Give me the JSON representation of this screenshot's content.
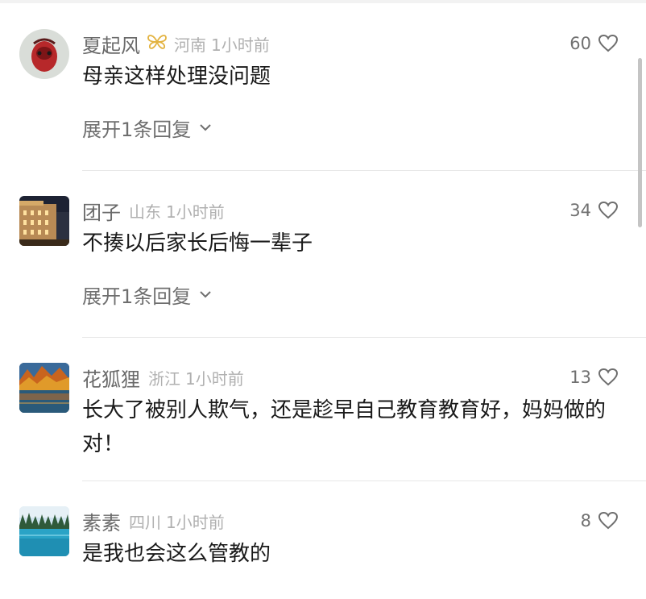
{
  "comments": [
    {
      "username": "夏起风",
      "badge_icon": "butterfly-badge-icon",
      "location": "河南",
      "time": "1小时前",
      "likes": "60",
      "text": "母亲这样处理没问题",
      "expand_label": "展开1条回复"
    },
    {
      "username": "团子",
      "location": "山东",
      "time": "1小时前",
      "likes": "34",
      "text": "不揍以后家长后悔一辈子",
      "expand_label": "展开1条回复"
    },
    {
      "username": "花狐狸",
      "location": "浙江",
      "time": "1小时前",
      "likes": "13",
      "text": "长大了被别人欺气，还是趁早自己教育教育好，妈妈做的对！"
    },
    {
      "username": "素素",
      "location": "四川",
      "time": "1小时前",
      "likes": "8",
      "text": "是我也会这么管教的"
    }
  ],
  "colors": {
    "text_primary": "#1a1a1a",
    "text_username": "#6a6a6a",
    "text_meta": "#b0b0b0",
    "badge_gold": "#e3b341",
    "divider": "#e8e8e8"
  }
}
